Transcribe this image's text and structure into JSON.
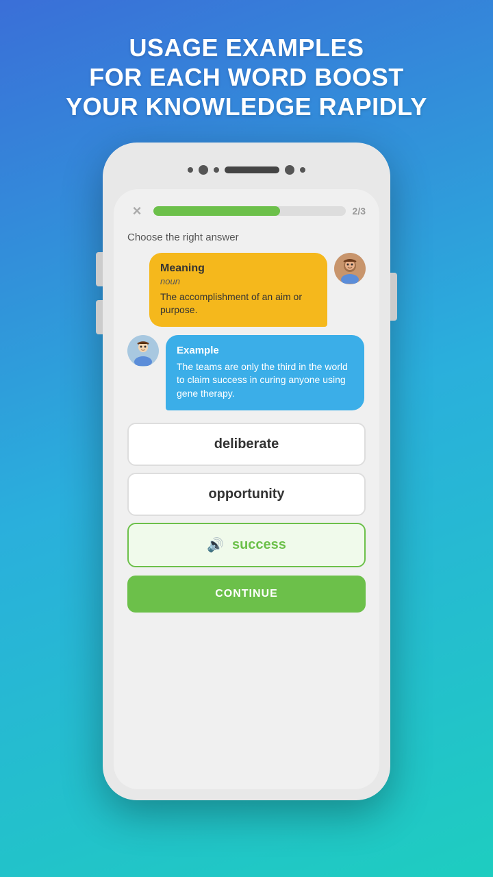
{
  "header": {
    "line1": "USAGE EXAMPLES",
    "line2": "FOR EACH WORD BOOST",
    "line3": "YOUR KNOWLEDGE RAPIDLY"
  },
  "phone": {
    "progress": {
      "close_label": "×",
      "fill_percent": 66,
      "counter": "2/3"
    },
    "instruction": "Choose the right answer",
    "meaning_card": {
      "title": "Meaning",
      "subtitle": "noun",
      "text": "The accomplishment of an aim or purpose."
    },
    "example_card": {
      "title": "Example",
      "text": "The teams are only the third in the world to claim success in curing anyone using gene therapy."
    },
    "answers": [
      {
        "label": "deliberate",
        "state": "default"
      },
      {
        "label": "opportunity",
        "state": "default"
      },
      {
        "label": "success",
        "state": "correct"
      }
    ],
    "continue_label": "CONTINUE"
  }
}
